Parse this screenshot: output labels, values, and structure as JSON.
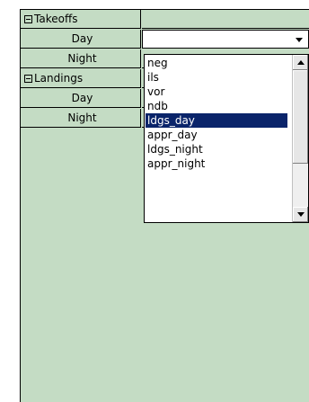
{
  "grid": {
    "groups": [
      {
        "label": "Takeoffs",
        "expanded": true,
        "children": [
          {
            "label": "Day",
            "value": ""
          },
          {
            "label": "Night",
            "value": ""
          }
        ]
      },
      {
        "label": "Landings",
        "expanded": true,
        "children": [
          {
            "label": "Day",
            "value": ""
          },
          {
            "label": "Night",
            "value": ""
          }
        ]
      }
    ]
  },
  "dropdown": {
    "items": [
      "neg",
      "ils",
      "vor",
      "ndb",
      "ldgs_day",
      "appr_day",
      "ldgs_night",
      "appr_night"
    ],
    "selected_index": 4
  },
  "icons": {
    "expander": "collapse-minus-icon",
    "combo_arrow": "chevron-down-icon",
    "scroll_up": "triangle-up-icon",
    "scroll_down": "triangle-down-icon"
  },
  "colors": {
    "grid_background": "#c4dcc4",
    "selection": "#0a246a",
    "selection_text": "#ffffff"
  }
}
